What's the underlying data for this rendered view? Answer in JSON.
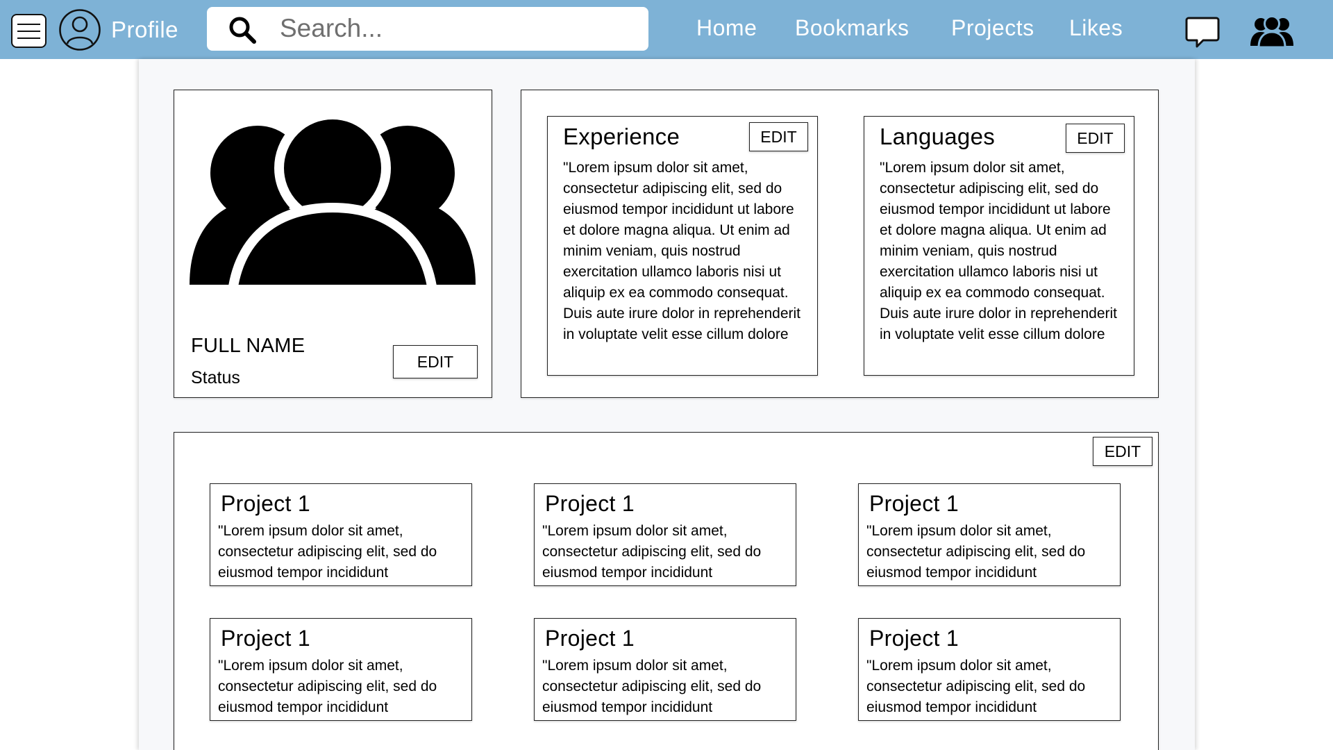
{
  "header": {
    "profile_label": "Profile",
    "search": {
      "placeholder": "Search..."
    },
    "nav": [
      "Home",
      "Bookmarks",
      "Projects",
      "Likes"
    ]
  },
  "profile": {
    "full_name": "FULL NAME",
    "status": "Status",
    "edit_label": "EDIT"
  },
  "experience": {
    "title": "Experience",
    "edit_label": "EDIT",
    "body": "\"Lorem ipsum dolor sit amet, consectetur adipiscing elit, sed do eiusmod tempor incididunt ut labore et dolore magna aliqua. Ut enim ad minim veniam, quis nostrud exercitation ullamco laboris nisi ut aliquip ex ea commodo consequat. Duis aute irure dolor in reprehenderit in voluptate velit esse cillum dolore"
  },
  "languages": {
    "title": "Languages",
    "edit_label": "EDIT",
    "body": "\"Lorem ipsum dolor sit amet, consectetur adipiscing elit, sed do eiusmod tempor incididunt ut labore et dolore magna aliqua. Ut enim ad minim veniam, quis nostrud exercitation ullamco laboris nisi ut aliquip ex ea commodo consequat. Duis aute irure dolor in reprehenderit in voluptate velit esse cillum dolore"
  },
  "projects": {
    "edit_label": "EDIT",
    "items": [
      {
        "title": "Project 1",
        "description": "\"Lorem ipsum dolor sit amet, consectetur adipiscing elit, sed do eiusmod tempor incididunt"
      },
      {
        "title": "Project 1",
        "description": "\"Lorem ipsum dolor sit amet, consectetur adipiscing elit, sed do eiusmod tempor incididunt"
      },
      {
        "title": "Project 1",
        "description": "\"Lorem ipsum dolor sit amet, consectetur adipiscing elit, sed do eiusmod tempor incididunt"
      },
      {
        "title": "Project 1",
        "description": "\"Lorem ipsum dolor sit amet, consectetur adipiscing elit, sed do eiusmod tempor incididunt"
      },
      {
        "title": "Project 1",
        "description": "\"Lorem ipsum dolor sit amet, consectetur adipiscing elit, sed do eiusmod tempor incididunt"
      },
      {
        "title": "Project 1",
        "description": "\"Lorem ipsum dolor sit amet, consectetur adipiscing elit, sed do eiusmod tempor incididunt"
      }
    ]
  },
  "icons": {
    "menu": "hamburger-menu-icon",
    "avatar": "user-avatar-icon",
    "search": "search-icon",
    "chat": "chat-bubble-icon",
    "group": "people-group-icon"
  },
  "colors": {
    "header_bg": "#7eb2d6",
    "header_text": "#ffffff",
    "content_bg": "#f7f8fa"
  }
}
